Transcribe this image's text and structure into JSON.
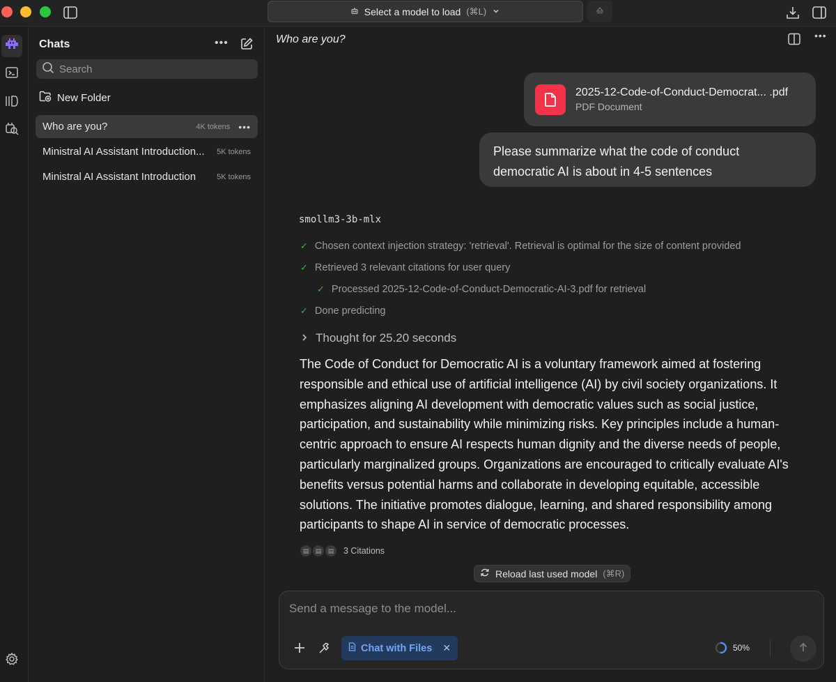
{
  "titlebar": {
    "model_select_label": "Select a model to load",
    "model_select_shortcut": "(⌘L)"
  },
  "rail": {
    "icons": [
      "robot-icon",
      "terminal-icon",
      "library-icon",
      "search-settings-icon",
      "settings-icon"
    ]
  },
  "sidebar": {
    "title": "Chats",
    "search_placeholder": "Search",
    "new_folder_label": "New Folder",
    "chats": [
      {
        "name": "Who are you?",
        "tokens": "4K tokens",
        "active": true
      },
      {
        "name": "Ministral AI Assistant Introduction...",
        "tokens": "5K tokens",
        "active": false
      },
      {
        "name": "Ministral AI Assistant Introduction",
        "tokens": "5K tokens",
        "active": false
      }
    ]
  },
  "main": {
    "chat_title": "Who are you?",
    "attachment": {
      "file_name": "2025-12-Code-of-Conduct-Democrat... .pdf",
      "file_type": "PDF Document"
    },
    "user_message": "Please summarize what the code of conduct democratic AI is about in 4-5 sentences",
    "model_name": "smollm3-3b-mlx",
    "steps": [
      "Chosen context injection strategy: 'retrieval'. Retrieval is optimal for the size of content provided",
      "Retrieved 3 relevant citations for user query",
      "Processed 2025-12-Code-of-Conduct-Democratic-AI-3.pdf for retrieval",
      "Done predicting"
    ],
    "thought_label": "Thought for 25.20 seconds",
    "answer": "The Code of Conduct for Democratic AI is a voluntary framework aimed at fostering responsible and ethical use of artificial intelligence (AI) by civil society organizations. It emphasizes aligning AI development with democratic values such as social justice, participation, and sustainability while minimizing risks. Key principles include a human-centric approach to ensure AI respects human dignity and the diverse needs of people, particularly marginalized groups. Organizations are encouraged to critically evaluate AI's benefits versus potential harms and collaborate in developing equitable, accessible solutions. The initiative promotes dialogue, learning, and shared responsibility among participants to shape AI in service of democratic processes.",
    "citations_label": "3 Citations",
    "reload_label": "Reload last used model",
    "reload_shortcut": "(⌘R)"
  },
  "composer": {
    "placeholder": "Send a message to the model...",
    "chat_with_files_label": "Chat with Files",
    "context_usage": "50%",
    "context_fraction": 0.5
  },
  "colors": {
    "accent_blue": "#6fa8f5",
    "pdf_red": "#f2334a",
    "check_green": "#3fae5b"
  }
}
